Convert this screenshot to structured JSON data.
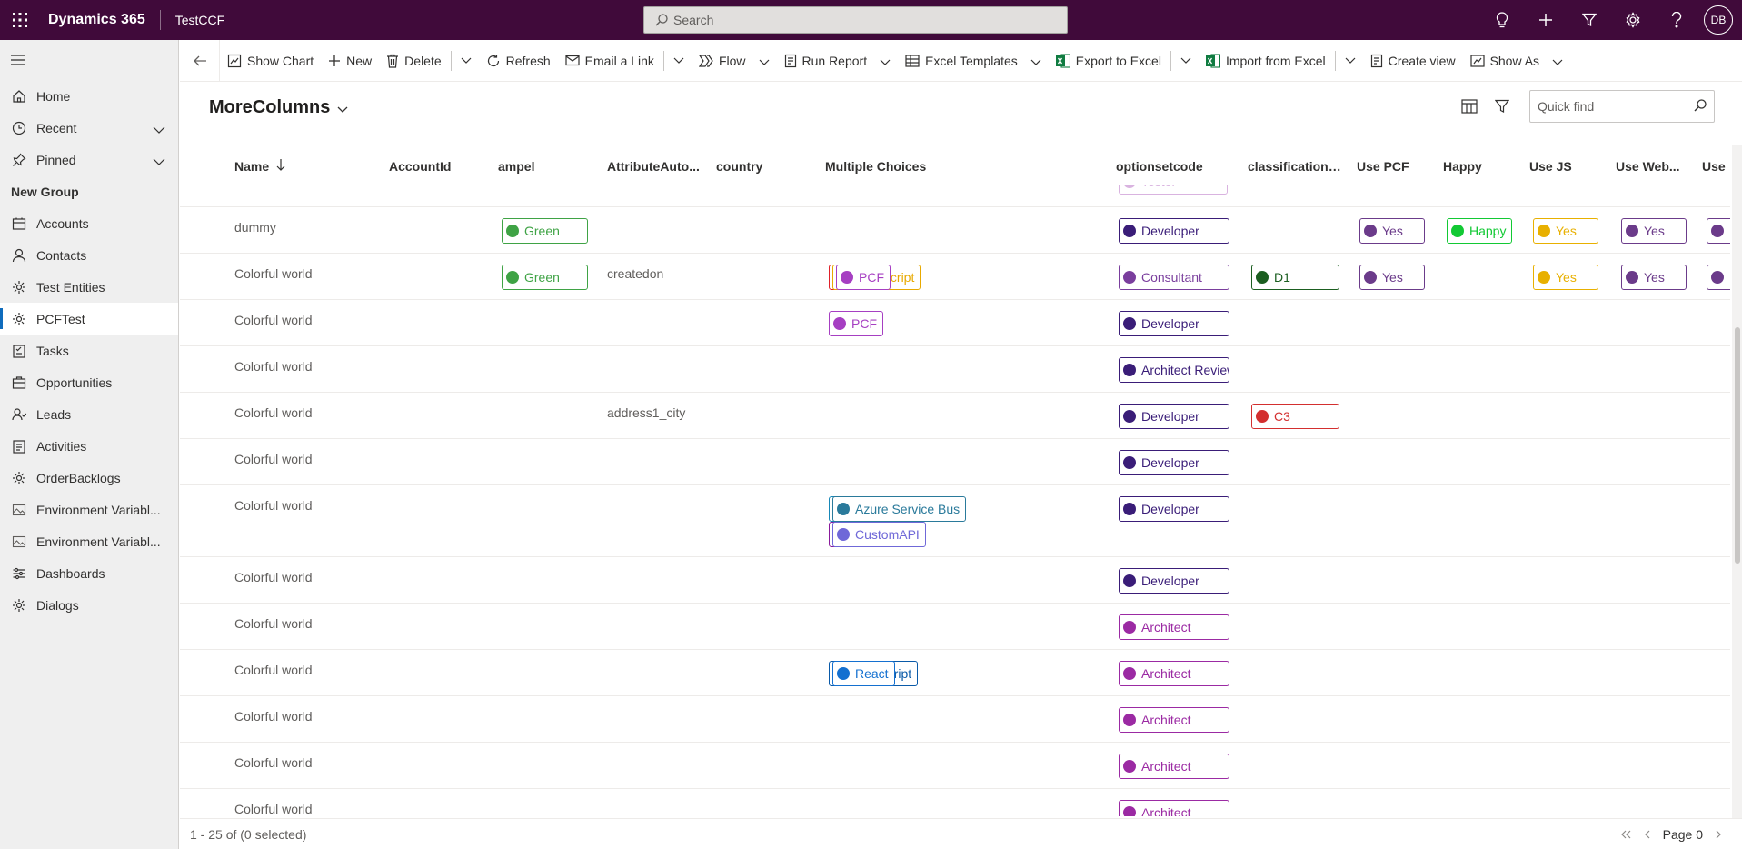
{
  "topbar": {
    "app_name": "Dynamics 365",
    "module": "TestCCF",
    "search_placeholder": "Search",
    "user_initials": "DB",
    "icons": [
      "lightbulb-icon",
      "plus-icon",
      "filter-icon",
      "gear-icon",
      "help-icon"
    ]
  },
  "sidebar": {
    "home": "Home",
    "recent": "Recent",
    "pinned": "Pinned",
    "group_title": "New Group",
    "items": [
      {
        "label": "Accounts",
        "icon": "accounts-icon"
      },
      {
        "label": "Contacts",
        "icon": "contact-icon"
      },
      {
        "label": "Test Entities",
        "icon": "entity-icon"
      },
      {
        "label": "PCFTest",
        "icon": "entity-icon"
      },
      {
        "label": "Tasks",
        "icon": "tasks-icon"
      },
      {
        "label": "Opportunities",
        "icon": "opportunity-icon"
      },
      {
        "label": "Leads",
        "icon": "leads-icon"
      },
      {
        "label": "Activities",
        "icon": "activities-icon"
      },
      {
        "label": "OrderBacklogs",
        "icon": "entity-icon"
      },
      {
        "label": "Environment Variabl...",
        "icon": "image-icon"
      },
      {
        "label": "Environment Variabl...",
        "icon": "image-icon"
      },
      {
        "label": "Dashboards",
        "icon": "dashboard-icon"
      },
      {
        "label": "Dialogs",
        "icon": "entity-icon"
      }
    ]
  },
  "commands": {
    "show_chart": "Show Chart",
    "new": "New",
    "delete": "Delete",
    "refresh": "Refresh",
    "email_link": "Email a Link",
    "flow": "Flow",
    "run_report": "Run Report",
    "excel_templates": "Excel Templates",
    "export_excel": "Export to Excel",
    "import_excel": "Import from Excel",
    "create_view": "Create view",
    "show_as": "Show As"
  },
  "view": {
    "title": "MoreColumns",
    "quick_find_placeholder": "Quick find"
  },
  "columns": [
    "Name",
    "AccountId",
    "ampel",
    "AttributeAuto...",
    "country",
    "Multiple Choices",
    "optionsetcode",
    "classificationc...",
    "Use PCF",
    "Happy",
    "Use JS",
    "Use Web...",
    "Use"
  ],
  "colors": {
    "green": "#3fa345",
    "developer": "#3a1d78",
    "consultant": "#7a3e9d",
    "architect": "#9b2aa3",
    "yes_purple": "#6b3b8a",
    "yes_yellow": "#e8b000",
    "happy": "#12c934",
    "nodejs": "#e0202a",
    "javascript": "#e8a900",
    "pcf": "#a63fc2",
    "azure_functions": "#1788b8",
    "azure_service_bus": "#2a7a9b",
    "plugins": "#8a1a9b",
    "customapi": "#6f68d8",
    "typescript": "#0a5aa8",
    "react": "#1470d0",
    "d1": "#1b5e20",
    "c3": "#d32f2f"
  },
  "rows": [
    {
      "name": "dummy",
      "ampel": "Green",
      "optionset": "Developer",
      "use_pcf": "Yes",
      "happy": "Happy",
      "use_js": "Yes",
      "use_web": "Yes"
    },
    {
      "name": "Colorful world",
      "ampel": "Green",
      "auto": "createdon",
      "choices": [
        "NodeJS",
        "JavaScript",
        "PCF"
      ],
      "optionset": "Consultant",
      "classification": "D1",
      "use_pcf": "Yes",
      "use_js": "Yes",
      "use_web": "Yes"
    },
    {
      "name": "Colorful world",
      "choices": [
        "PCF"
      ],
      "optionset": "Developer"
    },
    {
      "name": "Colorful world",
      "optionset": "Architect Review"
    },
    {
      "name": "Colorful world",
      "auto": "address1_city",
      "optionset": "Developer",
      "classification": "C3"
    },
    {
      "name": "Colorful world",
      "optionset": "Developer"
    },
    {
      "name": "Colorful world",
      "choices": [
        "Azure Functions",
        "Azure Service Bus",
        "PlugIns",
        "CustomAPI"
      ],
      "optionset": "Developer"
    },
    {
      "name": "Colorful world",
      "optionset": "Developer"
    },
    {
      "name": "Colorful world",
      "optionset": "Architect"
    },
    {
      "name": "Colorful world",
      "choices": [
        "TypeScript",
        "React"
      ],
      "optionset": "Architect"
    },
    {
      "name": "Colorful world",
      "optionset": "Architect"
    },
    {
      "name": "Colorful world",
      "optionset": "Architect"
    },
    {
      "name": "Colorful world",
      "optionset": "Architect"
    }
  ],
  "partial_top_chip": "Tester",
  "footer": {
    "count_text": "1 - 25 of (0 selected)",
    "page_text": "Page 0"
  }
}
